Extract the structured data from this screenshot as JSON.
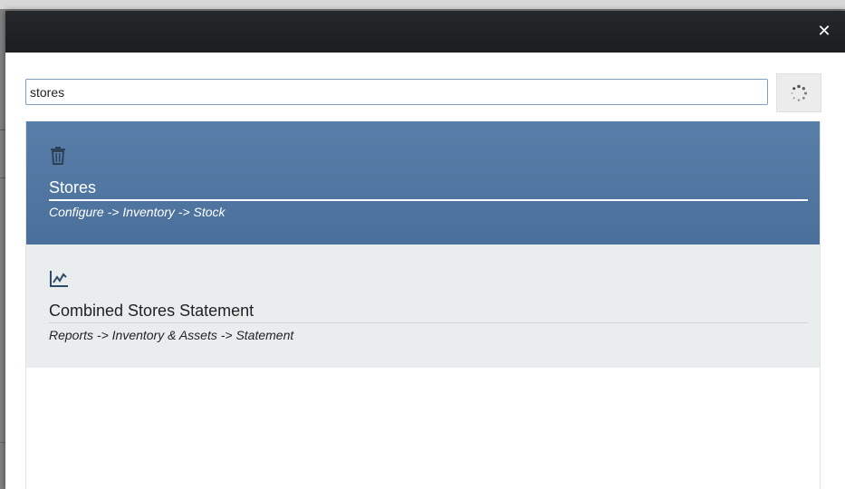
{
  "search": {
    "value": "stores"
  },
  "results": [
    {
      "icon": "trash-icon",
      "title": "Stores",
      "path": "Configure -> Inventory -> Stock",
      "selected": true
    },
    {
      "icon": "line-chart-icon",
      "title": "Combined Stores Statement",
      "path": "Reports -> Inventory & Assets -> Statement",
      "selected": false
    }
  ],
  "colors": {
    "header": "#1f2326",
    "selected_row": "#4f75a1",
    "normal_row": "#eaedee",
    "input_border": "#7e9fc2"
  },
  "icons": {
    "close": "close-icon",
    "spinner": "spinner-icon"
  }
}
